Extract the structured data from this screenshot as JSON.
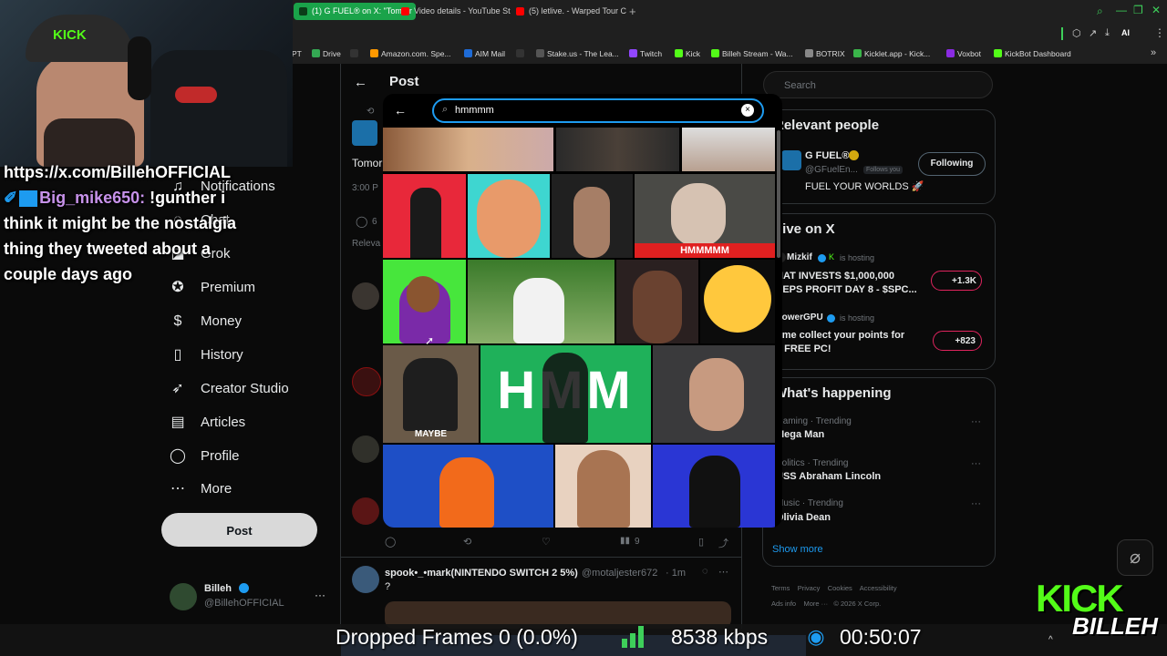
{
  "browser": {
    "tabs": [
      {
        "label": "(1) G FUEL® on X: \"Tomorr",
        "color": "#1aa34a",
        "active": true
      },
      {
        "label": "Video details - YouTube St",
        "color": "#ff0000",
        "active": false
      },
      {
        "label": "(5) letlive. - Warped Tour C",
        "color": "#ff0000",
        "active": false
      }
    ],
    "new_tab": "+",
    "bookmarks": [
      {
        "label": "PT",
        "color": "#444"
      },
      {
        "label": "Drive",
        "color": "#34a853"
      },
      {
        "label": "X",
        "color": "#000"
      },
      {
        "label": "Amazon.com. Spe...",
        "color": "#ff9900"
      },
      {
        "label": "AIM Mail",
        "color": "#1e6bd6"
      },
      {
        "label": "X",
        "color": "#000"
      },
      {
        "label": "Stake.us - The Lea...",
        "color": "#555"
      },
      {
        "label": "Twitch",
        "color": "#9146ff"
      },
      {
        "label": "Kick",
        "color": "#53fc18"
      },
      {
        "label": "Billeh Stream - Wa...",
        "color": "#53fc18"
      },
      {
        "label": "BOTRIX",
        "color": "#888"
      },
      {
        "label": "Kicklet.app - Kick...",
        "color": "#3ab54a"
      },
      {
        "label": "Voxbot",
        "color": "#8a2be2"
      },
      {
        "label": "KickBot Dashboard",
        "color": "#53fc18"
      }
    ],
    "ai_label": "AI"
  },
  "nav": {
    "items": [
      {
        "label": "Notifications",
        "icon": "bell-icon",
        "glyph": "🔔"
      },
      {
        "label": "Chat",
        "icon": "chat-icon",
        "glyph": "💬"
      },
      {
        "label": "Grok",
        "icon": "grok-icon",
        "glyph": "◪"
      },
      {
        "label": "Premium",
        "icon": "premium-icon",
        "glyph": "✪"
      },
      {
        "label": "Money",
        "icon": "money-icon",
        "glyph": "$"
      },
      {
        "label": "History",
        "icon": "bookmark-icon",
        "glyph": "▯"
      },
      {
        "label": "Creator Studio",
        "icon": "rocket-icon",
        "glyph": "➶"
      },
      {
        "label": "Articles",
        "icon": "articles-icon",
        "glyph": "▤"
      },
      {
        "label": "Profile",
        "icon": "profile-icon",
        "glyph": "◯"
      },
      {
        "label": "More",
        "icon": "more-icon",
        "glyph": "⋯"
      }
    ],
    "post_button": "Post",
    "account": {
      "name": "Billeh",
      "handle": "@BillehOFFICIAL",
      "more": "···"
    }
  },
  "middle": {
    "header": "Post",
    "tweet_snippet": "Tomor",
    "time_snippet": "3:00 P",
    "reply_count": "6",
    "relevant_label": "Releva",
    "views": "9",
    "reply": {
      "author": "spook•_•mark(NINTENDO SWITCH 2 5%)",
      "handle": "@motaljester672",
      "time": "· 1m",
      "text": "?"
    }
  },
  "right": {
    "search_placeholder": "Search",
    "relevant_people": {
      "title": "Relevant people",
      "name": "G FUEL®",
      "handle": "@GFuelEn...",
      "follows_you": "Follows you",
      "bio": "FUEL YOUR WORLDS 🚀",
      "button": "Following"
    },
    "live": {
      "title": "Live on X",
      "items": [
        {
          "host": "Mizkif",
          "status": "is hosting",
          "title1": "HAT INVESTS $1,000,000",
          "title2": "EEPS PROFIT DAY 8 - $SPC...",
          "count": "+1.3K"
        },
        {
          "host": "PowerGPU",
          "status": "is hosting",
          "title1": "ome collect your points for",
          "title2": "e FREE PC!",
          "count": "+823"
        }
      ]
    },
    "happening": {
      "title": "What's happening",
      "items": [
        {
          "category": "Gaming · Trending",
          "name": "Mega Man"
        },
        {
          "category": "Politics · Trending",
          "name": "USS Abraham Lincoln"
        },
        {
          "category": "Music · Trending",
          "name": "Olivia Dean"
        }
      ],
      "show_more": "Show more"
    },
    "footer": [
      "Terms",
      "Privacy",
      "Cookies",
      "Accessibility",
      "Ads info",
      "More ···",
      "© 2026 X Corp."
    ]
  },
  "chat_overlay": {
    "url_line": "https://x.com/BillehOFFICIAL",
    "user": "Big_mike650:",
    "message_first": "!gunther i",
    "message_lines": [
      "think it might be the nostalgia",
      "thing they tweeted about a",
      "couple days ago"
    ]
  },
  "gif_picker": {
    "query": "hmmmm",
    "labels": {
      "hmmmm_caption": "HMMMMM",
      "hmm_big": "HMM",
      "maybe_caption": "MAYBE"
    }
  },
  "obs": {
    "dropped_frames": "Dropped Frames 0 (0.0%)",
    "bitrate": "8538 kbps",
    "timer": "00:50:07"
  },
  "overlay_brand": {
    "kick": "KICK",
    "billeh": "BILLEH"
  },
  "colors": {
    "accent": "#1d9bf0",
    "kick_green": "#53fc18",
    "follow_bg": "#eff3f4"
  }
}
